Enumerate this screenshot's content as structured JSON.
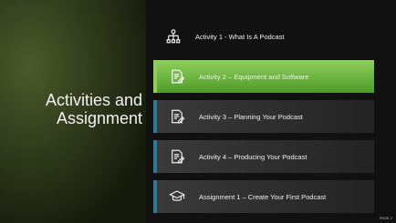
{
  "title": {
    "line1": "Activities and",
    "line2": "Assignment"
  },
  "items": [
    {
      "label": "Activity 1 - What Is A Podcast",
      "icon": "network-icon",
      "state": "plain"
    },
    {
      "label": "Activity 2 – Equipment and Software",
      "icon": "document-edit-icon",
      "state": "active"
    },
    {
      "label": "Activity 3 – Planning Your Podcast",
      "icon": "document-edit-icon",
      "state": "dark"
    },
    {
      "label": "Activity 4 – Producing Your Podcast",
      "icon": "document-edit-icon",
      "state": "dark"
    },
    {
      "label": "Assignment 1 – Create Your First Podcast",
      "icon": "graduation-cap-icon",
      "state": "dark"
    }
  ],
  "page_label": "PAGE 2",
  "colors": {
    "active": "#6ab63a",
    "accent_bar": "#2c7b96",
    "tile_dark": "#2e2e2e"
  }
}
